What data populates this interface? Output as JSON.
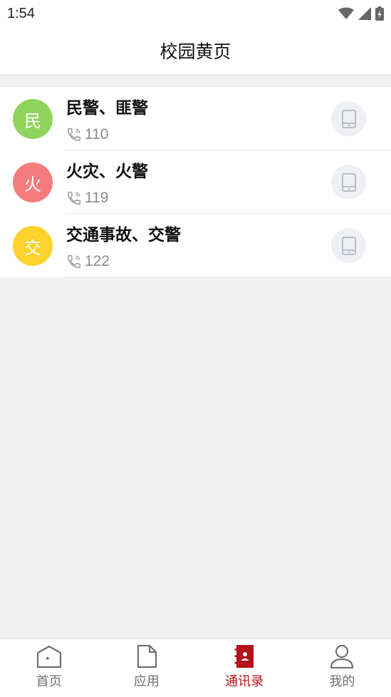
{
  "status_bar": {
    "time": "1:54"
  },
  "header": {
    "title": "校园黄页"
  },
  "contacts": [
    {
      "avatar_char": "民",
      "avatar_color": "#8fd45c",
      "name": "民警、匪警",
      "number": "110"
    },
    {
      "avatar_char": "火",
      "avatar_color": "#f47c7c",
      "name": "火灾、火警",
      "number": "119"
    },
    {
      "avatar_char": "交",
      "avatar_color": "#fdd22c",
      "name": "交通事故、交警",
      "number": "122"
    }
  ],
  "tabs": [
    {
      "label": "首页",
      "icon": "home-icon",
      "active": false
    },
    {
      "label": "应用",
      "icon": "document-icon",
      "active": false
    },
    {
      "label": "通讯录",
      "icon": "contacts-book-icon",
      "active": true
    },
    {
      "label": "我的",
      "icon": "person-icon",
      "active": false
    }
  ],
  "colors": {
    "accent": "#b5121b",
    "tab_inactive": "#707070",
    "background": "#f0f0f0",
    "dial_button_bg": "#eef0f5"
  }
}
